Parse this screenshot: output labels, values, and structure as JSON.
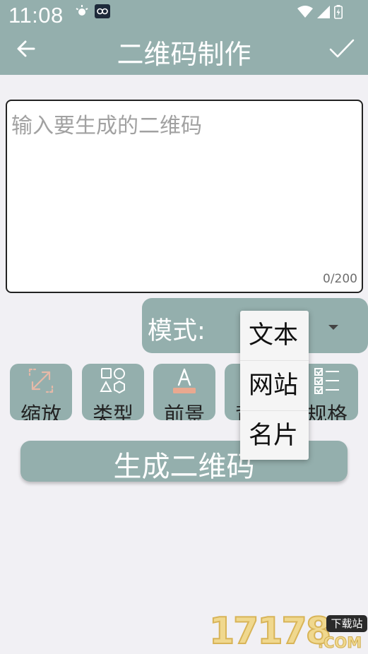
{
  "status_bar": {
    "time": "11:08",
    "left_icons": [
      "brightness-icon",
      "app-notification-icon"
    ],
    "right_icons": [
      "wifi-icon",
      "signal-icon",
      "battery-charging-icon"
    ]
  },
  "header": {
    "title": "二维码制作",
    "back_icon": "arrow-left-icon",
    "confirm_icon": "check-icon",
    "color": "#94afad"
  },
  "input": {
    "placeholder": "输入要生成的二维码",
    "counter": "0/200"
  },
  "mode": {
    "label": "模式:",
    "caret_icon": "caret-down-icon"
  },
  "tools": [
    {
      "label": "缩放",
      "icon": "expand-arrows-icon"
    },
    {
      "label": "类型",
      "icon": "shapes-icon"
    },
    {
      "label": "前景",
      "icon": "text-color-icon"
    },
    {
      "label": "背景",
      "icon": "background-icon"
    },
    {
      "label": "规格",
      "icon": "checklist-icon"
    }
  ],
  "generate_button": {
    "label": "生成二维码"
  },
  "dropdown": {
    "options": [
      "文本",
      "网站",
      "名片"
    ]
  },
  "watermark": {
    "number": "17178",
    "domain": ".COM",
    "badge": "下载站"
  }
}
